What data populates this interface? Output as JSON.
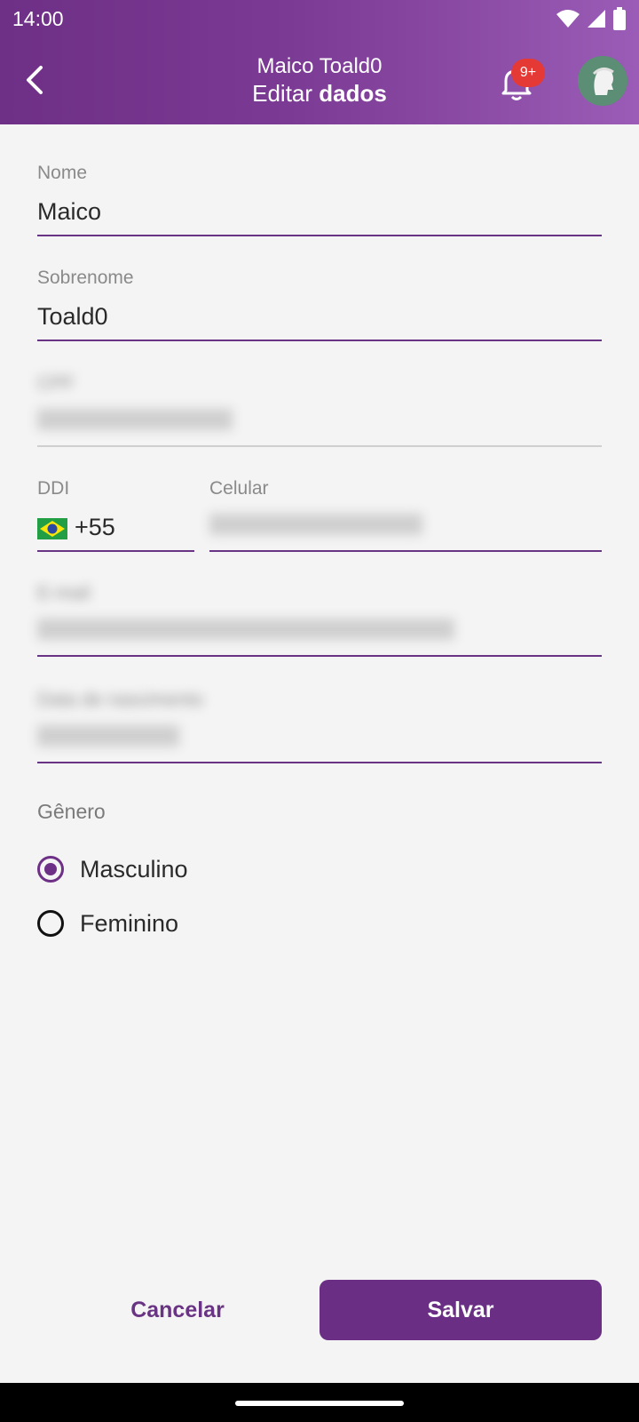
{
  "status_bar": {
    "time": "14:00"
  },
  "header": {
    "subtitle": "Maico Toald0",
    "title_regular": "Editar ",
    "title_bold": "dados",
    "notification_badge": "9+"
  },
  "form": {
    "nome": {
      "label": "Nome",
      "value": "Maico"
    },
    "sobrenome": {
      "label": "Sobrenome",
      "value": "Toald0"
    },
    "cpf": {
      "label": "CPF",
      "value": ""
    },
    "ddi": {
      "label": "DDI",
      "value": "+55",
      "flag": "brazil-flag-icon"
    },
    "celular": {
      "label": "Celular",
      "value": ""
    },
    "email": {
      "label": "E-mail",
      "value": ""
    },
    "nascimento": {
      "label": "Data de nascimento",
      "value": ""
    },
    "genero": {
      "label": "Gênero",
      "options": [
        {
          "label": "Masculino",
          "selected": true
        },
        {
          "label": "Feminino",
          "selected": false
        }
      ]
    }
  },
  "actions": {
    "cancel": "Cancelar",
    "save": "Salvar"
  },
  "colors": {
    "primary": "#6e2f86",
    "accent": "#9a5cb6",
    "badge": "#e53935",
    "background": "#f4f4f4"
  }
}
